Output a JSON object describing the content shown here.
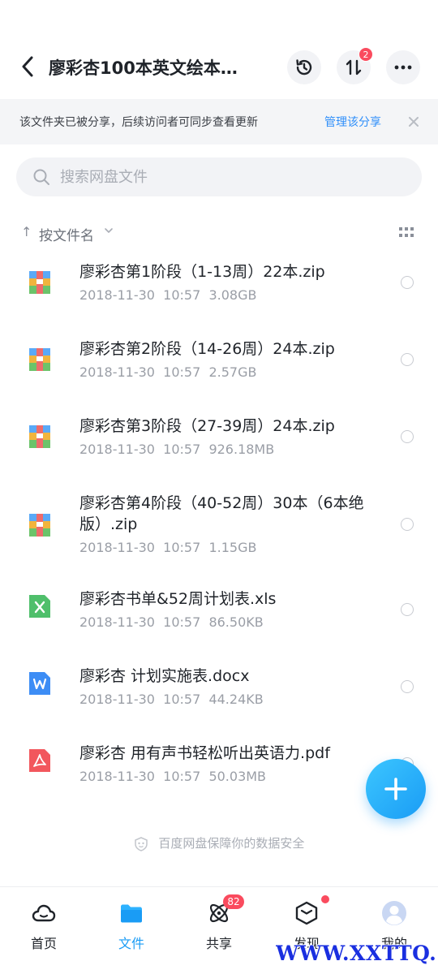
{
  "header": {
    "title": "廖彩杏100本英文绘本…",
    "transfer_badge": "2"
  },
  "share_banner": {
    "text": "该文件夹已被分享，后续访问者可同步查看更新",
    "link": "管理该分享"
  },
  "search": {
    "placeholder": "搜索网盘文件"
  },
  "sort": {
    "label": "按文件名"
  },
  "files": [
    {
      "name": "廖彩杏第1阶段（1-13周）22本.zip",
      "date": "2018-11-30",
      "time": "10:57",
      "size": "3.08GB",
      "type": "zip-icon"
    },
    {
      "name": "廖彩杏第2阶段（14-26周）24本.zip",
      "date": "2018-11-30",
      "time": "10:57",
      "size": "2.57GB",
      "type": "zip-icon"
    },
    {
      "name": "廖彩杏第3阶段（27-39周）24本.zip",
      "date": "2018-11-30",
      "time": "10:57",
      "size": "926.18MB",
      "type": "zip-icon"
    },
    {
      "name": "廖彩杏第4阶段（40-52周）30本（6本绝版）.zip",
      "date": "2018-11-30",
      "time": "10:57",
      "size": "1.15GB",
      "type": "zip-icon"
    },
    {
      "name": "廖彩杏书单&52周计划表.xls",
      "date": "2018-11-30",
      "time": "10:57",
      "size": "86.50KB",
      "type": "excel-icon"
    },
    {
      "name": "廖彩杏 计划实施表.docx",
      "date": "2018-11-30",
      "time": "10:57",
      "size": "44.24KB",
      "type": "word-icon"
    },
    {
      "name": "廖彩杏 用有声书轻松听出英语力.pdf",
      "date": "2018-11-30",
      "time": "10:57",
      "size": "50.03MB",
      "type": "pdf-icon"
    }
  ],
  "footer": {
    "safety_text": "百度网盘保障你的数据安全"
  },
  "tabbar": {
    "items": [
      {
        "label": "首页",
        "icon": "cloud-icon"
      },
      {
        "label": "文件",
        "icon": "folder-icon"
      },
      {
        "label": "共享",
        "icon": "atom-icon",
        "badge": "82"
      },
      {
        "label": "发现",
        "icon": "cube-icon"
      },
      {
        "label": "我的",
        "icon": "avatar-icon"
      }
    ]
  },
  "watermark": "WWW.XXTTQ.COM",
  "colors": {
    "accent": "#1a9cf5",
    "badge": "#fa4b5e",
    "link": "#2f8ffa"
  }
}
